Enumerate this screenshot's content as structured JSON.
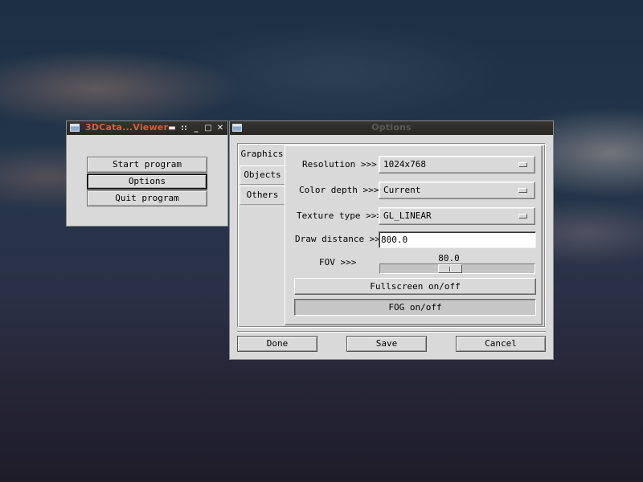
{
  "main_window": {
    "title": "3DCata...Viewer",
    "buttons": {
      "start": "Start program",
      "options": "Options",
      "quit": "Quit program"
    },
    "focused_button": "options"
  },
  "titlebar_controls": {
    "menu": "▬",
    "shade": "::",
    "minimize": "_",
    "maximize": "□",
    "close": "✕"
  },
  "options_window": {
    "title": "Options",
    "tabs": [
      {
        "label": "Graphics",
        "active": true
      },
      {
        "label": "Objects",
        "active": false
      },
      {
        "label": "Others",
        "active": false
      }
    ],
    "graphics": {
      "resolution": {
        "label": "Resolution >>>",
        "value": "1024x768"
      },
      "color_depth": {
        "label": "Color depth >>>",
        "value": "Current"
      },
      "texture_type": {
        "label": "Texture type >>>",
        "value": "GL_LINEAR"
      },
      "draw_distance": {
        "label": "Draw distance >>>",
        "value": "800.0"
      },
      "fov": {
        "label": "FOV >>>",
        "value": 80.0,
        "display": "80.0",
        "min": 0,
        "max": 180
      },
      "fullscreen_label": "Fullscreen on/off",
      "fog_label": "FOG on/off",
      "fog_pressed": true
    },
    "buttons": {
      "done": "Done",
      "save": "Save",
      "cancel": "Cancel"
    }
  },
  "colors": {
    "active_title": "#e25a3a",
    "inactive_title": "#5a5a55",
    "window_bg": "#d9d9d9",
    "titlebar_bg": "#2f2d29"
  }
}
